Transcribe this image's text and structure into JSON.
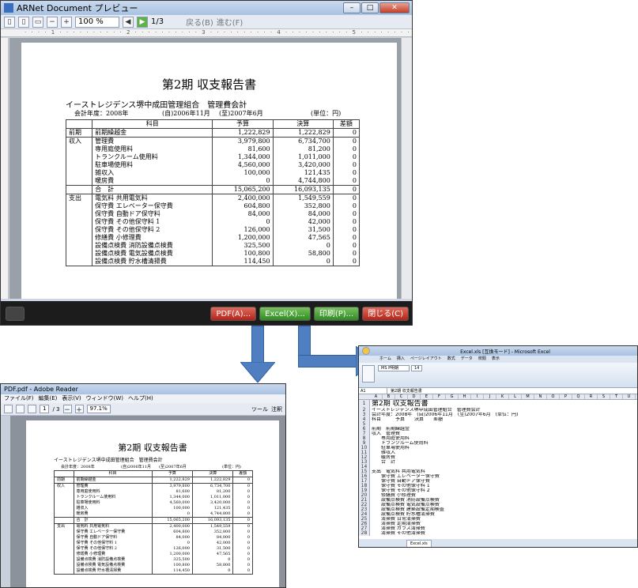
{
  "preview_window": {
    "title": "ARNet Document プレビュー",
    "zoom": "100 %",
    "page_indicator": "1/3",
    "back_label": "戻る(B)",
    "forward_label": "進む(F)",
    "buttons": {
      "pdf": "PDF(A)...",
      "excel": "Excel(X)...",
      "print": "印刷(P)...",
      "close": "閉じる(C)"
    }
  },
  "report": {
    "title": "第2期 収支報告書",
    "org": "イーストレジデンス堺中成田管理組合　管理費会計",
    "fiscal_year": "会計年度：2008年",
    "period_from": "(自)2006年11月",
    "period_to": "(至)2007年6月",
    "unit": "(単位：円)",
    "headers": [
      "科目",
      "予算",
      "決算",
      "差額"
    ],
    "sections": [
      {
        "group": "前期",
        "rows": [
          [
            "前期繰越金",
            "1,222,829",
            "1,222,829",
            "0"
          ]
        ]
      },
      {
        "group": "収入",
        "rows": [
          [
            "管理費",
            "3,979,800",
            "6,734,700",
            "0"
          ],
          [
            "専用庭使用料",
            "81,600",
            "81,200",
            "0"
          ],
          [
            "トランクルーム使用料",
            "1,344,000",
            "1,011,000",
            "0"
          ],
          [
            "駐車場使用料",
            "4,560,000",
            "3,420,000",
            "0"
          ],
          [
            "雑収入",
            "100,000",
            "121,435",
            "0"
          ],
          [
            "暖房費",
            "0",
            "4,744,800",
            "0"
          ]
        ]
      },
      {
        "group": "",
        "rows": [
          [
            "合　計",
            "15,065,200",
            "16,093,135",
            "0"
          ]
        ]
      },
      {
        "group": "支出",
        "rows": [
          [
            "電気料 共用電気料",
            "2,400,000",
            "1,549,559",
            "0"
          ],
          [
            "保守費 エレベーター保守費",
            "604,800",
            "352,800",
            "0"
          ],
          [
            "保守費 自動ドア保守料",
            "84,000",
            "84,000",
            "0"
          ],
          [
            "保守費 その他保守料 1",
            "0",
            "42,000",
            "0"
          ],
          [
            "保守費 その他保守料 2",
            "126,000",
            "31,500",
            "0"
          ],
          [
            "修繕費 小修理費",
            "1,200,000",
            "47,565",
            "0"
          ],
          [
            "設備点検費 消防設備点検費",
            "325,500",
            "0",
            "0"
          ],
          [
            "設備点検費 電気設備点検費",
            "100,800",
            "58,800",
            "0"
          ],
          [
            "設備点検費 貯水槽清掃費",
            "114,450",
            "0",
            "0"
          ]
        ]
      }
    ]
  },
  "excel_window": {
    "title": "Excel.xls [互換モード] - Microsoft Excel",
    "tabs": [
      "ホーム",
      "挿入",
      "ページレイアウト",
      "数式",
      "データ",
      "校閲",
      "表示"
    ],
    "font_name": "MS P明朝",
    "font_size": "14",
    "cell_ref": "A1",
    "formula": "第2期 収支報告書",
    "sheet_tab": "Excel.xls",
    "columns": [
      "A",
      "B",
      "C",
      "D",
      "E",
      "F",
      "G",
      "H",
      "I",
      "J",
      "K",
      "L",
      "M",
      "N",
      "O",
      "P",
      "Q",
      "R",
      "S",
      "T",
      "U"
    ],
    "rows": [
      "第2期 収支報告書",
      "イーストレジデンス堺中成田管理組合　管理費会計",
      "会計年度：2008年　(自)2006年11月　(至)2007年6月　(単位：円)",
      "科目　　　予算　　決算　　差額",
      "",
      "前期　前期繰越金",
      "収入　管理費",
      "　　専用庭使用料",
      "　　トランクルーム使用料",
      "　　駐車場使用料",
      "　　雑収入",
      "　　暖房費",
      "　　合　計",
      "",
      "支出　電気料 共用電気料",
      "　　保守費 エレベーター保守費",
      "　　保守費 自動ドア保守費",
      "　　保守費 その他保守料 1",
      "　　保守費 その他保守料 2",
      "　　修繕費 小修理費",
      "　　設備点検費 消防設備点検費",
      "　　設備点検費 電気設備点検費",
      "　　設備点検費 建築設備定期検査",
      "　　設備点検費 貯水槽清掃費",
      "　　清掃費 日常清掃費",
      "　　清掃費 定期清掃費",
      "　　清掃費 ガラス清掃費",
      "　　清掃費 その他清掃費"
    ]
  },
  "pdf_window": {
    "title": "PDF.pdf - Adobe Reader",
    "menu": [
      "ファイル(F)",
      "編集(E)",
      "表示(V)",
      "ウィンドウ(W)",
      "ヘルプ(H)"
    ],
    "page": "1",
    "page_total": "/ 3",
    "zoom": "97.1%",
    "tools_label": "ツール",
    "comment_label": "注釈",
    "rows_visible": 23
  }
}
